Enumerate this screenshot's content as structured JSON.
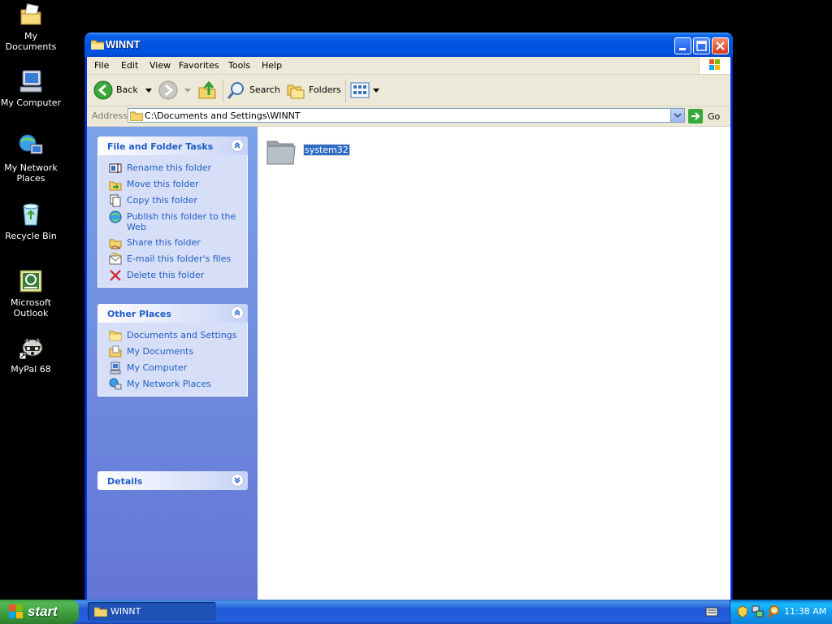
{
  "desktop": {
    "icons": [
      {
        "label": "My Documents"
      },
      {
        "label": "My Computer"
      },
      {
        "label": "My Network Places"
      },
      {
        "label": "Recycle Bin"
      },
      {
        "label": "Microsoft Outlook"
      },
      {
        "label": "MyPal 68"
      }
    ]
  },
  "window": {
    "title": "WINNT"
  },
  "menu": [
    "File",
    "Edit",
    "View",
    "Favorites",
    "Tools",
    "Help"
  ],
  "toolbar": {
    "back": "Back",
    "search": "Search",
    "folders": "Folders"
  },
  "address": {
    "label": "Address",
    "path": "C:\\Documents and Settings\\WINNT",
    "go": "Go"
  },
  "tasks": {
    "file_folder": {
      "title": "File and Folder Tasks",
      "items": [
        "Rename this folder",
        "Move this folder",
        "Copy this folder",
        "Publish this folder to the Web",
        "Share this folder",
        "E-mail this folder's files",
        "Delete this folder"
      ]
    },
    "other_places": {
      "title": "Other Places",
      "items": [
        "Documents and Settings",
        "My Documents",
        "My Computer",
        "My Network Places"
      ]
    },
    "details": {
      "title": "Details"
    }
  },
  "files": [
    {
      "name": "system32",
      "selected": true
    }
  ],
  "taskbar": {
    "start": "start",
    "active_window": "WINNT",
    "clock": "11:38 AM"
  },
  "colors": {
    "titlebar": "#0053e1",
    "taskpane_link": "#215dc6",
    "selection": "#316ac5"
  }
}
